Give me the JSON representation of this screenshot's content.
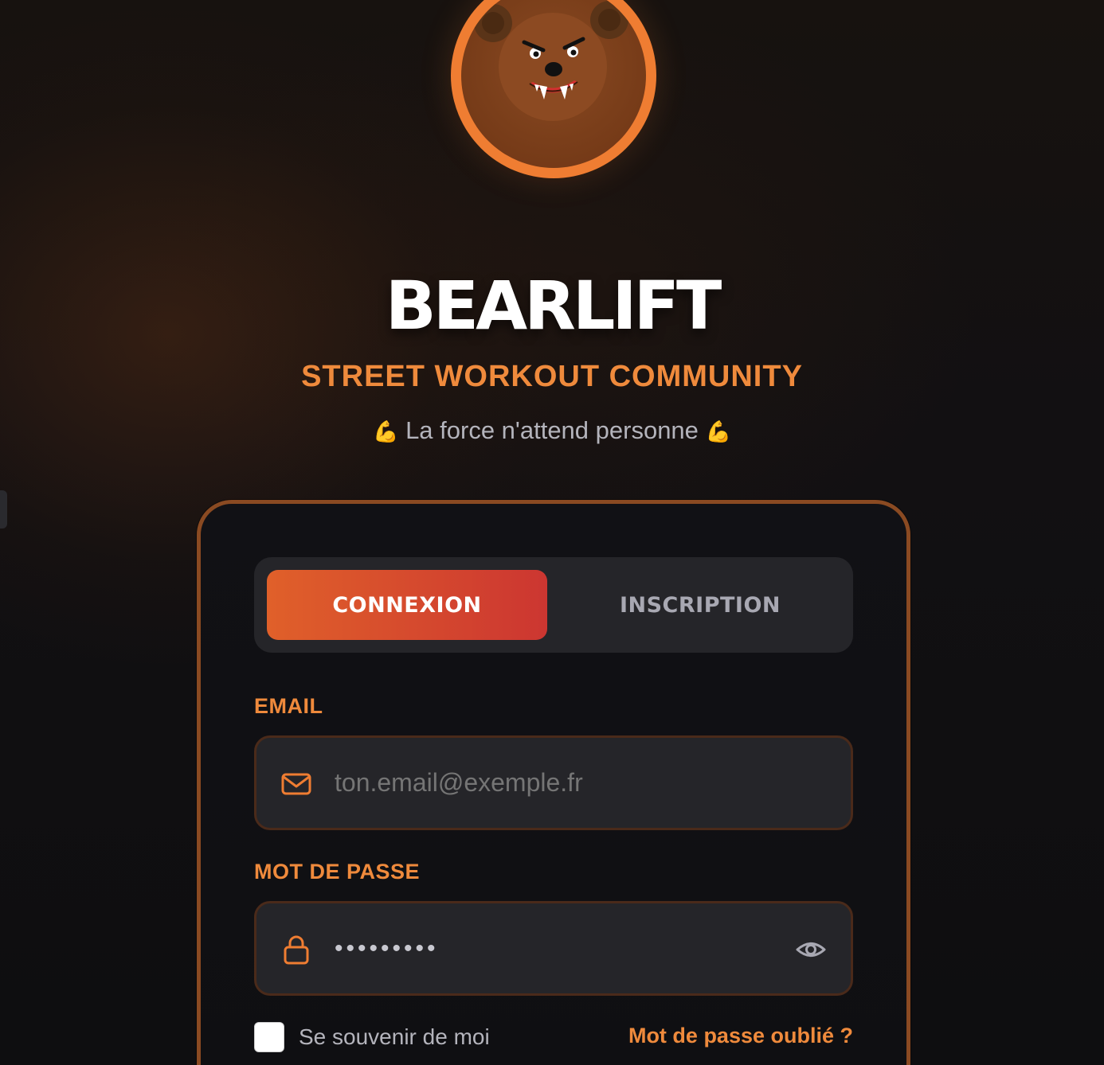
{
  "brand": {
    "title": "BEARLIFT",
    "subtitle": "STREET WORKOUT COMMUNITY",
    "tagline_text": "La force n'attend personne",
    "tagline_emoji": "💪"
  },
  "tabs": {
    "login_label": "CONNEXION",
    "register_label": "INSCRIPTION",
    "active": "login"
  },
  "form": {
    "email_label": "EMAIL",
    "email_placeholder": "ton.email@exemple.fr",
    "email_value": "",
    "password_label": "MOT DE PASSE",
    "password_value": "•••••••••",
    "remember_label": "Se souvenir de moi",
    "remember_checked": false,
    "forgot_label": "Mot de passe oublié ?"
  },
  "icons": {
    "logo": "bear-logo",
    "email": "mail-icon",
    "password": "lock-icon",
    "toggle_visibility": "eye-icon"
  },
  "colors": {
    "accent": "#ef8a3c",
    "ring": "#ef7d32",
    "card_border": "#8a4a22",
    "tab_gradient_start": "#e0602a",
    "tab_gradient_end": "#cc3631",
    "input_bg": "#252529"
  }
}
